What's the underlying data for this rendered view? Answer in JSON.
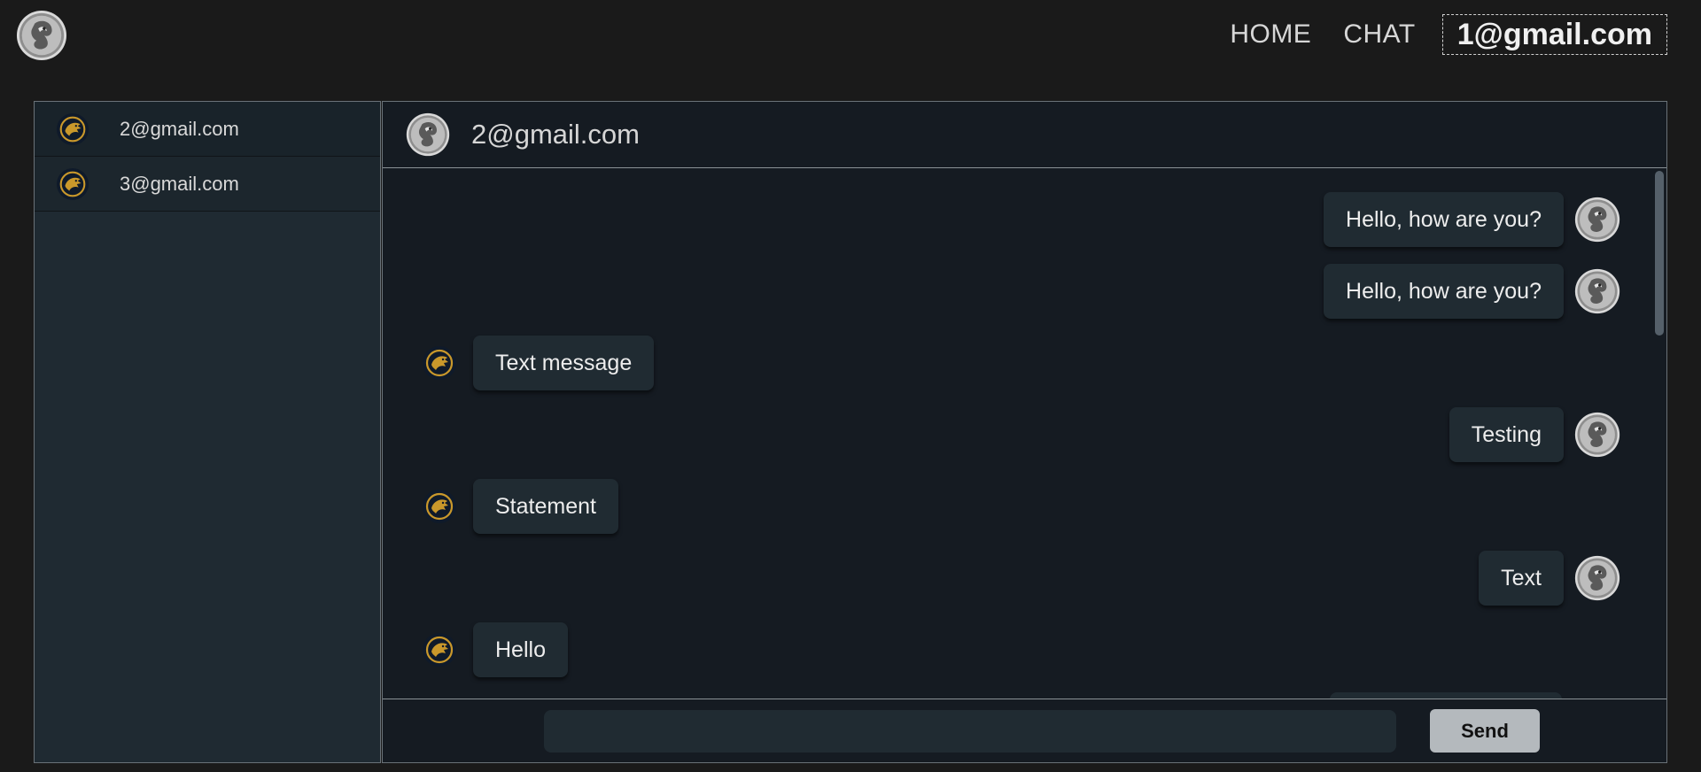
{
  "nav": {
    "logo_icon": "dragon-logo-icon",
    "home_label": "HOME",
    "chat_label": "CHAT",
    "user_email": "1@gmail.com"
  },
  "contacts": [
    {
      "email": "2@gmail.com",
      "avatar_icon": "gold-dragon-avatar-icon"
    },
    {
      "email": "3@gmail.com",
      "avatar_icon": "gold-dragon-avatar-icon"
    }
  ],
  "chat": {
    "title": "2@gmail.com",
    "header_avatar_icon": "silver-dragon-avatar-icon",
    "messages": [
      {
        "text": "Hello, how are you?",
        "direction": "out"
      },
      {
        "text": "Hello, how are you?",
        "direction": "out"
      },
      {
        "text": "Text message",
        "direction": "in"
      },
      {
        "text": "Testing",
        "direction": "out"
      },
      {
        "text": "Statement",
        "direction": "in"
      },
      {
        "text": "Text",
        "direction": "out"
      },
      {
        "text": "Hello",
        "direction": "in"
      }
    ],
    "input_value": "",
    "send_label": "Send"
  },
  "colors": {
    "page_bg": "#1a1a1a",
    "panel_bg": "#151b22",
    "bubble_bg": "#202b32",
    "gold_accent": "#c9982b",
    "send_button": "#b4b9bd"
  }
}
